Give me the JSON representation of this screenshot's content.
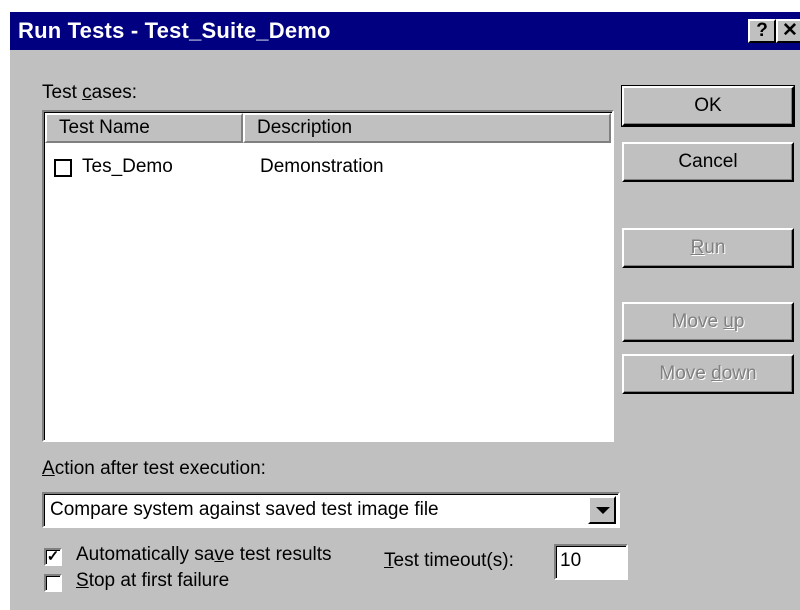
{
  "window": {
    "title": "Run Tests - Test_Suite_Demo",
    "help_btn": "?",
    "close_btn": "✕"
  },
  "test_cases": {
    "label_pre": "Test ",
    "label_accel": "c",
    "label_post": "ases:",
    "columns": [
      "Test Name",
      "Description"
    ],
    "rows": [
      {
        "name": "Tes_Demo",
        "description": "Demonstration",
        "checked": false
      }
    ]
  },
  "buttons": {
    "ok": "OK",
    "cancel": "Cancel",
    "run_accel": "R",
    "run_post": "un",
    "move_up_pre": "Move ",
    "move_up_accel": "u",
    "move_up_post": "p",
    "move_down_pre": "Move ",
    "move_down_accel": "d",
    "move_down_post": "own"
  },
  "action": {
    "label_accel": "A",
    "label_post": "ction after test execution:",
    "selected": "Compare system against saved test image file"
  },
  "options": {
    "auto_save_pre": "Automatically sa",
    "auto_save_accel": "v",
    "auto_save_post": "e test results",
    "auto_save_checked": true,
    "stop_accel": "S",
    "stop_post": "top at first failure",
    "stop_checked": false,
    "timeout_accel": "T",
    "timeout_post": "est timeout(s):",
    "timeout_value": "10"
  }
}
